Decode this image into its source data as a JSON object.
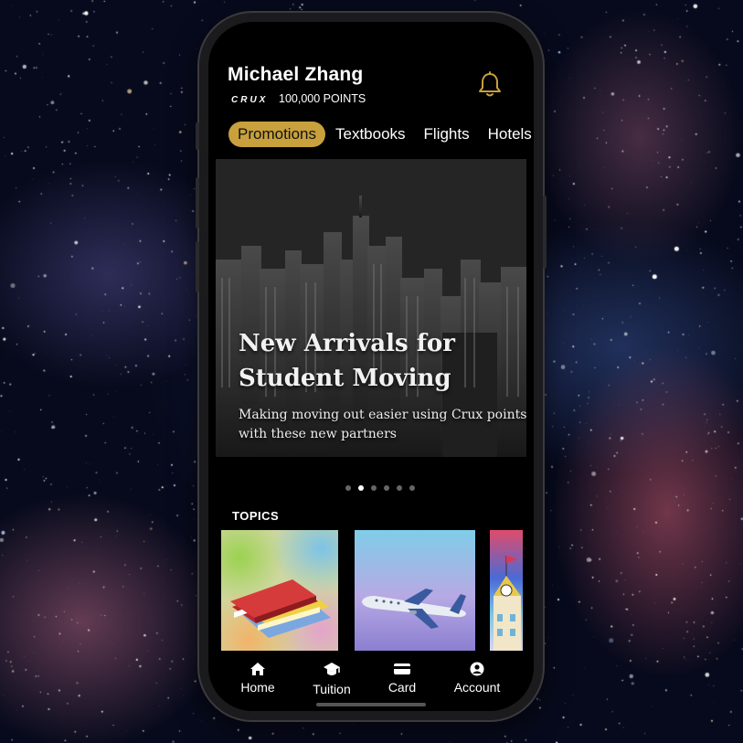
{
  "header": {
    "user_name": "Michael Zhang",
    "brand": "CRUX",
    "points_label": "100,000 POINTS"
  },
  "tabs": [
    {
      "label": "Promotions",
      "active": true
    },
    {
      "label": "Textbooks",
      "active": false
    },
    {
      "label": "Flights",
      "active": false
    },
    {
      "label": "Hotels",
      "active": false
    }
  ],
  "banner": {
    "title_line1": "New Arrivals for",
    "title_line2": "Student Moving",
    "subtitle_line1": "Making moving out easier using Crux points",
    "subtitle_line2": "with these new partners",
    "page_count": 6,
    "active_page": 2
  },
  "topics": {
    "title": "TOPICS",
    "items": [
      {
        "icon": "textbooks-icon"
      },
      {
        "icon": "airplane-icon"
      },
      {
        "icon": "school-building-icon"
      }
    ]
  },
  "nav": [
    {
      "label": "Home",
      "icon": "home-icon"
    },
    {
      "label": "Tuition",
      "icon": "graduation-cap-icon"
    },
    {
      "label": "Card",
      "icon": "credit-card-icon"
    },
    {
      "label": "Account",
      "icon": "account-icon"
    }
  ],
  "colors": {
    "accent": "#c8a13d",
    "screen_background": "#000000",
    "text": "#ffffff"
  }
}
